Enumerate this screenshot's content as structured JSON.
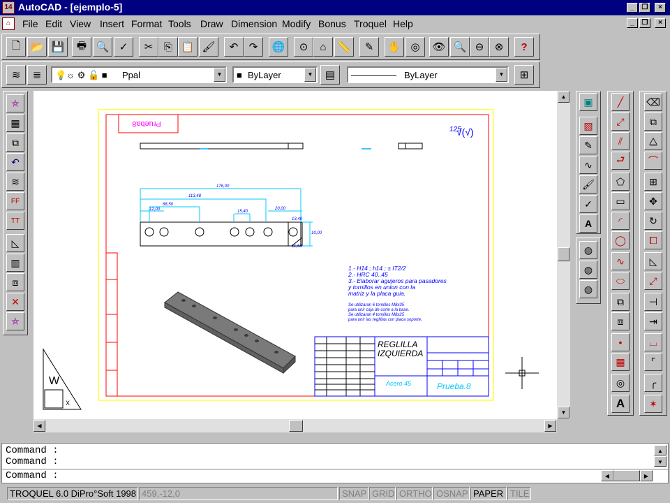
{
  "app": {
    "title": "AutoCAD - [ejemplo-5]",
    "icon_text": "14"
  },
  "menu": [
    "File",
    "Edit",
    "View",
    "Insert",
    "Format",
    "Tools",
    "Draw",
    "Dimension",
    "Modify",
    "Bonus",
    "Troquel",
    "Help"
  ],
  "layers": {
    "current_layer": "Ppal",
    "color": "ByLayer",
    "linetype": "ByLayer"
  },
  "drawing": {
    "title_line1": "REGLILLA",
    "title_line2": "IZQUIERDA",
    "material": "Acero 45",
    "name": "Prueba.8",
    "roughness": "125",
    "notes": [
      "1.- H14 ; h14 ; ± IT2/2",
      "2.- HRC 40..45",
      "3.- Elaborar agujeros para pasadores",
      "    y tornillos en union con la",
      "    matriz y la placa guia."
    ],
    "notes_small": [
      "Se utilizaran 6 tornillos M8x35",
      "para unir caja de corte a la base.",
      "Se utilizaran 4 tornillos M8x25",
      "para unir las reglillas con placa soporte."
    ],
    "dim_total": "176,00",
    "dim_2": "113,48",
    "dim_3": "68,50",
    "dim_4": "15,40",
    "dim_5": "20,00",
    "dim_6": "12,00",
    "dim_7": "13,40",
    "dim_8": "11,50",
    "dim_9": "10,00",
    "dim_10": "12,80",
    "mirror_label": "Prueba8"
  },
  "commands": [
    "Command :",
    "Command :",
    "Command :"
  ],
  "status": {
    "app_label": "TROQUEL 6.0 DiPro°Soft 1998",
    "coords": "459,-12,0",
    "toggles": [
      {
        "label": "SNAP",
        "on": false
      },
      {
        "label": "GRID",
        "on": false
      },
      {
        "label": "ORTHO",
        "on": false
      },
      {
        "label": "OSNAP",
        "on": false
      },
      {
        "label": "PAPER",
        "on": true
      },
      {
        "label": "TILE",
        "on": false
      }
    ]
  },
  "colors": {
    "title_bg": "#000080",
    "chrome": "#c0c0c0",
    "drawing_blue": "#0000ff",
    "drawing_red": "#ff0000",
    "border_yellow": "#ffff00"
  }
}
